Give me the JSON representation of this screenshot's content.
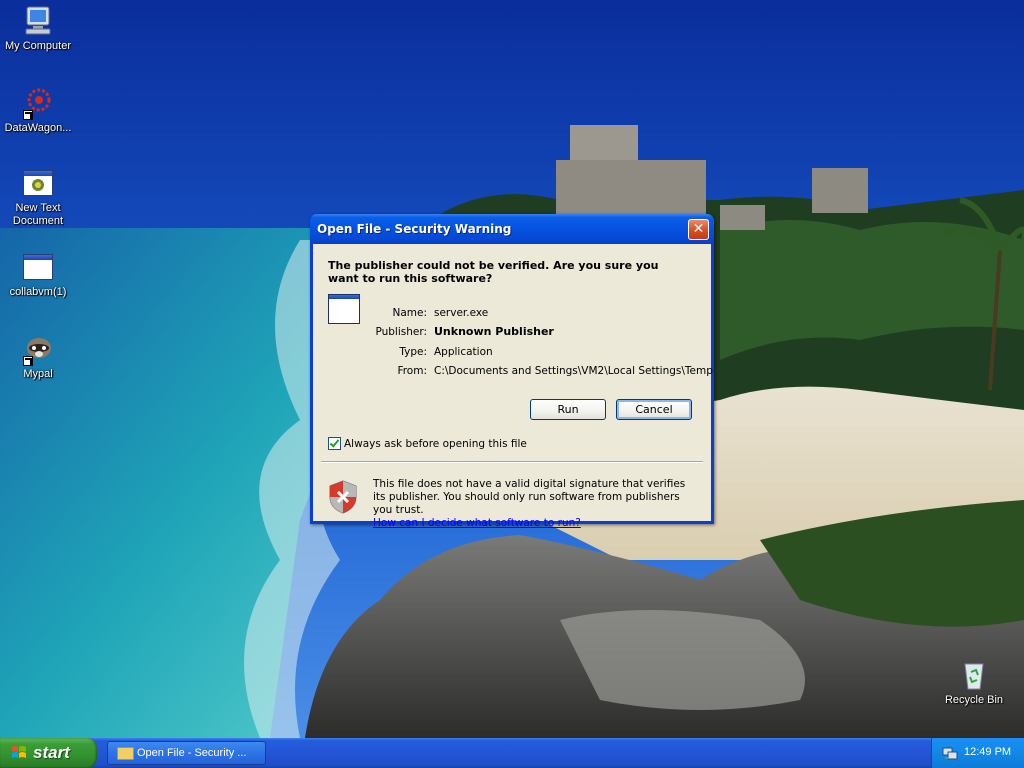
{
  "desktop": {
    "icons": [
      {
        "label": "My Computer"
      },
      {
        "label": "DataWagon..."
      },
      {
        "label": "New Text Document"
      },
      {
        "label": "collabvm(1)"
      },
      {
        "label": "Mypal"
      },
      {
        "label": "Recycle Bin"
      }
    ]
  },
  "dialog": {
    "title": "Open File - Security Warning",
    "close_glyph": "✕",
    "question": "The publisher could not be verified.  Are you sure you want to run this software?",
    "properties": {
      "name_label": "Name:",
      "name_value": "server.exe",
      "publisher_label": "Publisher:",
      "publisher_value": "Unknown Publisher",
      "type_label": "Type:",
      "type_value": "Application",
      "from_label": "From:",
      "from_value": "C:\\Documents and Settings\\VM2\\Local Settings\\Temp"
    },
    "run_label": "Run",
    "cancel_label": "Cancel",
    "checkbox_label": "Always ask before opening this file",
    "checkbox_checked": true,
    "warning_text": "This file does not have a valid digital signature that verifies its publisher.  You should only run software from publishers you trust.",
    "help_link": "How can I decide what software to run?"
  },
  "taskbar": {
    "start_label": "start",
    "task_button_label": "Open File - Security ...",
    "clock": "12:49 PM"
  },
  "colors": {
    "title_bar": "#0553e0",
    "dialog_bg": "#ece9d8",
    "taskbar": "#245edb",
    "start_button": "#3c9e37",
    "link": "#0000ff"
  },
  "icons": [
    "computer-icon",
    "datawagon-icon",
    "text-document-icon",
    "application-icon",
    "raccoon-icon",
    "recycle-bin-icon",
    "shield-warning-icon",
    "windows-logo-icon",
    "folder-icon",
    "network-icon"
  ]
}
